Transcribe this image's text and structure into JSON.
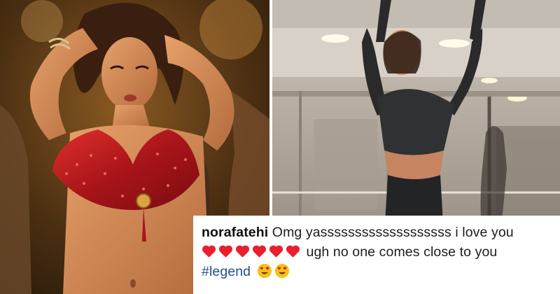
{
  "left_photo": {
    "subject": "dancer-in-red-sequin-top",
    "background_color": "#4a2e12"
  },
  "right_photo": {
    "subject": "dancer-in-mirror-studio",
    "background_color": "#b9b1a7"
  },
  "comment": {
    "username": "norafatehi",
    "text_line1": "Omg yasssssssssssssssssss i love you",
    "heart_count": 6,
    "text_line2": "ugh no one comes close to you",
    "hashtag": "#legend",
    "emoji_count": 2,
    "username_color": "#111111",
    "hashtag_color": "#1f4f86",
    "heart_color": "#e8202e",
    "emoji_color": "#f5c21b"
  }
}
